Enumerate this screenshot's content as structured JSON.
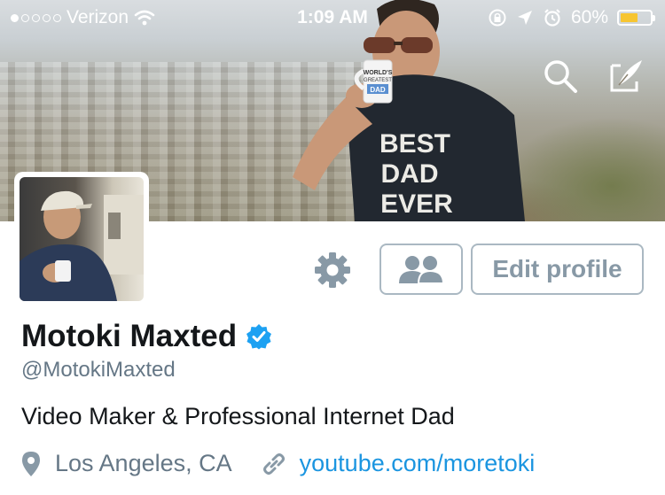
{
  "status_bar": {
    "carrier": "Verizon",
    "signal_bars_filled": 1,
    "signal_bars_total": 5,
    "time": "1:09 AM",
    "battery_percent_text": "60%",
    "battery_level": 0.6,
    "battery_color": "#f7c531"
  },
  "header": {
    "search_icon": "search-icon",
    "compose_icon": "compose-tweet-icon",
    "shirt_text": [
      "BEST",
      "DAD",
      "EVER"
    ],
    "mug_text": [
      "WORLD'S",
      "GREATEST",
      "DAD"
    ]
  },
  "profile": {
    "name": "Motoki Maxted",
    "verified": true,
    "handle": "@MotokiMaxted",
    "bio": "Video Maker & Professional Internet Dad",
    "location": "Los Angeles, CA",
    "url": "youtube.com/moretoki"
  },
  "actions": {
    "settings_icon": "gear-icon",
    "people_icon": "people-icon",
    "edit_label": "Edit profile"
  },
  "colors": {
    "accent": "#1b95e0",
    "verified_badge": "#1da1f2",
    "button_border": "#aab8c2",
    "secondary_text": "#657786"
  }
}
